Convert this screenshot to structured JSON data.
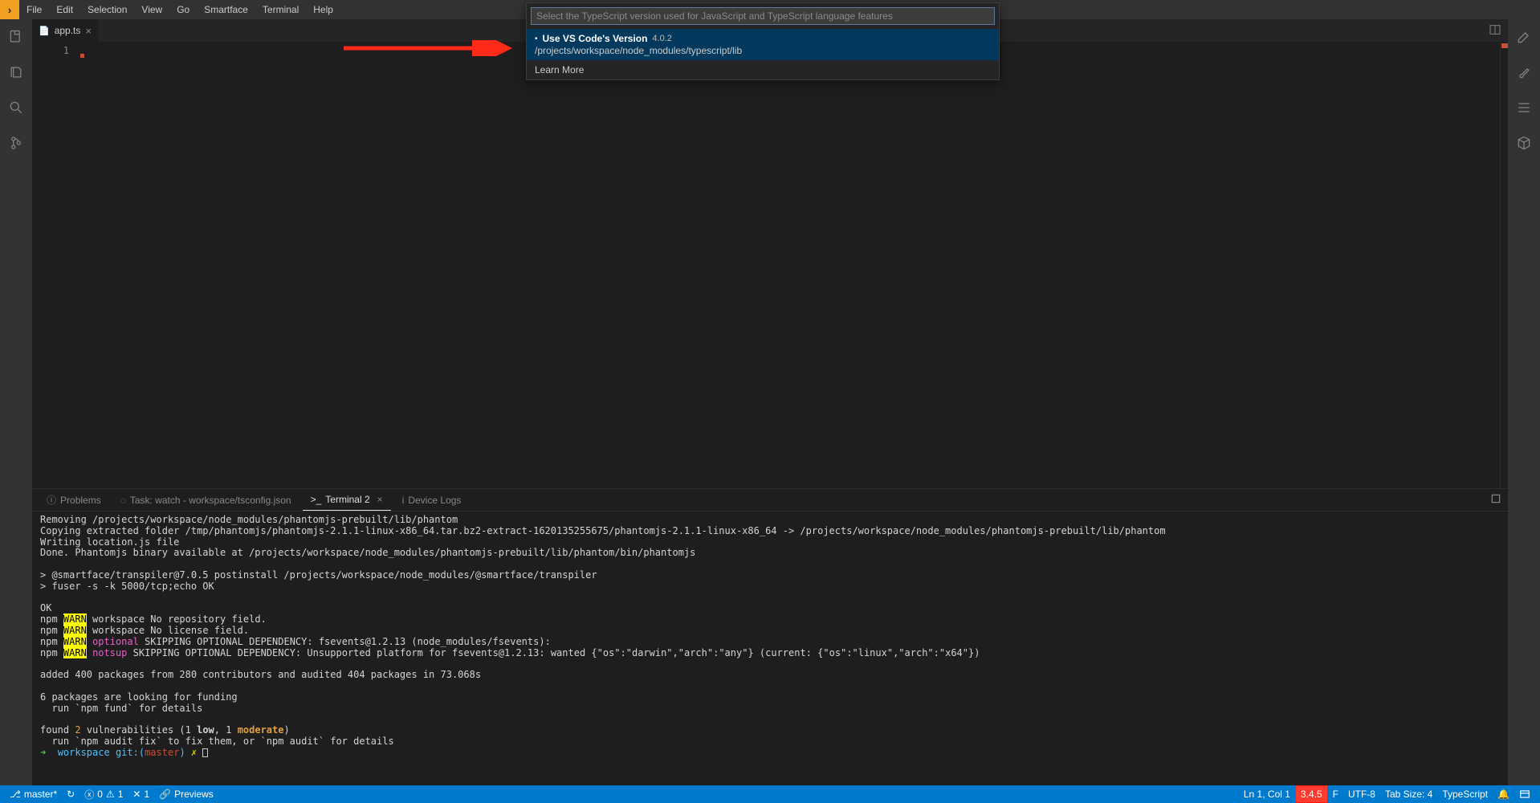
{
  "menubar": {
    "items": [
      "File",
      "Edit",
      "Selection",
      "View",
      "Go",
      "Smartface",
      "Terminal",
      "Help"
    ]
  },
  "tab": {
    "filename": "app.ts"
  },
  "editor": {
    "line_number": "1"
  },
  "quickpick": {
    "placeholder": "Select the TypeScript version used for JavaScript and TypeScript language features",
    "item1_title": "Use VS Code's Version",
    "item1_version": "4.0.2",
    "item1_desc": "/projects/workspace/node_modules/typescript/lib",
    "item2_title": "Learn More"
  },
  "panel": {
    "tabs": {
      "problems": "Problems",
      "task": "Task: watch - workspace/tsconfig.json",
      "terminal": "Terminal 2",
      "devicelogs": "Device Logs"
    }
  },
  "terminal": {
    "l1": "Removing /projects/workspace/node_modules/phantomjs-prebuilt/lib/phantom",
    "l2": "Copying extracted folder /tmp/phantomjs/phantomjs-2.1.1-linux-x86_64.tar.bz2-extract-1620135255675/phantomjs-2.1.1-linux-x86_64 -> /projects/workspace/node_modules/phantomjs-prebuilt/lib/phantom",
    "l3": "Writing location.js file",
    "l4": "Done. Phantomjs binary available at /projects/workspace/node_modules/phantomjs-prebuilt/lib/phantom/bin/phantomjs",
    "l5": "> @smartface/transpiler@7.0.5 postinstall /projects/workspace/node_modules/@smartface/transpiler",
    "l6": "> fuser -s -k 5000/tcp;echo OK",
    "l7": "OK",
    "npm": "npm",
    "warn": "WARN",
    "w1": " workspace No repository field.",
    "w2": " workspace No license field.",
    "optional": "optional",
    "w3": " SKIPPING OPTIONAL DEPENDENCY: fsevents@1.2.13 (node_modules/fsevents):",
    "notsup": "notsup",
    "w4": " SKIPPING OPTIONAL DEPENDENCY: Unsupported platform for fsevents@1.2.13: wanted {\"os\":\"darwin\",\"arch\":\"any\"} (current: {\"os\":\"linux\",\"arch\":\"x64\"})",
    "l8": "added 400 packages from 280 contributors and audited 404 packages in 73.068s",
    "l9": "6 packages are looking for funding",
    "l10": "  run `npm fund` for details",
    "found": "found ",
    "vuln_count": "2",
    "vuln_mid": " vulnerabilities (1 ",
    "low": "low",
    "comma": ", 1 ",
    "moderate": "moderate",
    "close_paren": ")",
    "l12": "  run `npm audit fix` to fix them, or `npm audit` for details",
    "prompt_arrow": "➜",
    "prompt_wd": "workspace",
    "prompt_git": "git:(",
    "prompt_branch": "master",
    "prompt_close": ")",
    "prompt_x": "✗"
  },
  "statusbar": {
    "branch": "master*",
    "errors": "0",
    "warnings": "1",
    "xcount": "1",
    "previews": "Previews",
    "ln_col": "Ln 1, Col 1",
    "ts_version": "3.4.5",
    "f": "F",
    "encoding": "UTF-8",
    "tab_size": "Tab Size: 4",
    "language": "TypeScript"
  }
}
